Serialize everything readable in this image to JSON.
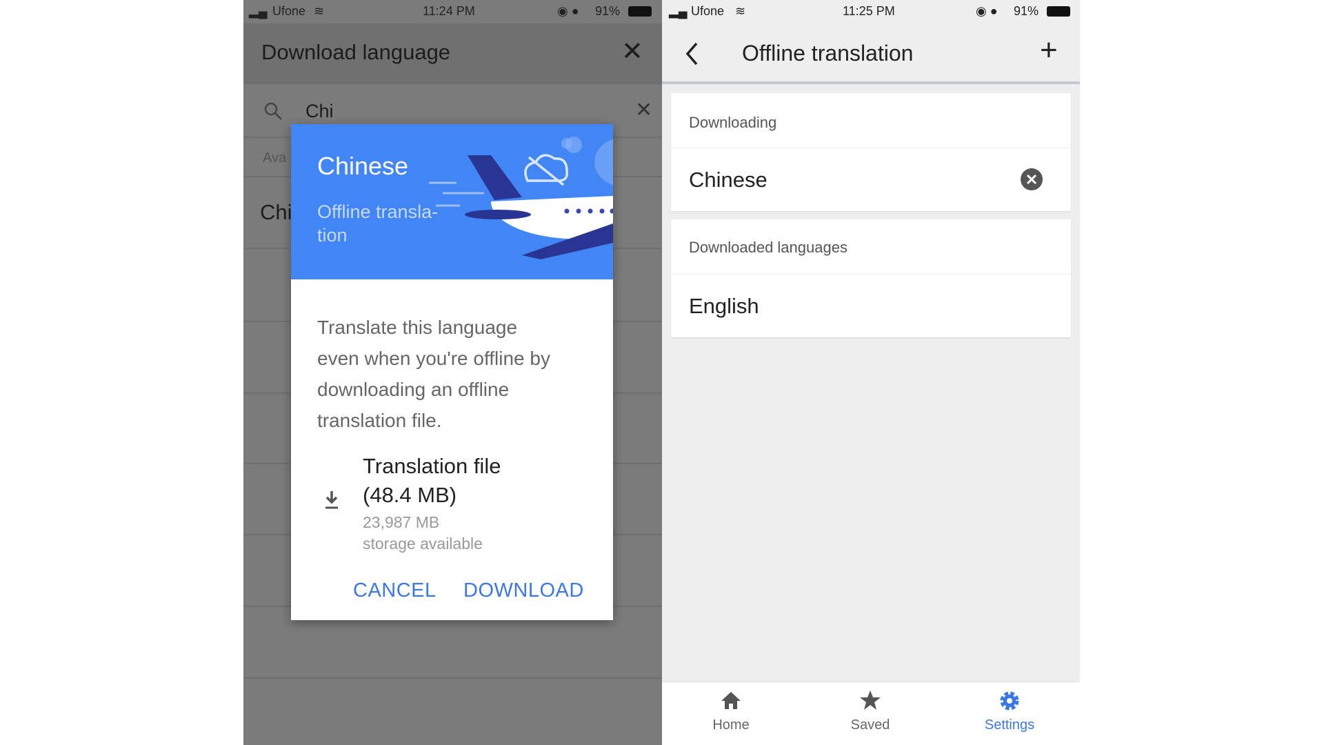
{
  "left_screen": {
    "status": {
      "carrier": "Ufone",
      "time": "11:24 PM",
      "battery": "91%"
    },
    "header": {
      "title": "Download language"
    },
    "search": {
      "value": "Chi"
    },
    "section_header_partial": "Ava",
    "list_item_partial": "Chi",
    "dialog": {
      "title": "Chinese",
      "subtitle_line1": "Offline transla-",
      "subtitle_line2": "tion",
      "body_lines": [
        "Translate this language",
        "even when you're offline by",
        "downloading an offline",
        "translation file."
      ],
      "file_label": "Translation file",
      "file_size": "(48.4 MB)",
      "storage_value": "23,987 MB",
      "storage_label": "storage available",
      "cancel": "CANCEL",
      "download": "DOWNLOAD",
      "accent": "#4285f4"
    }
  },
  "right_screen": {
    "status": {
      "carrier": "Ufone",
      "time": "11:25 PM",
      "battery": "91%"
    },
    "header": {
      "title": "Offline translation"
    },
    "downloading": {
      "header": "Downloading",
      "items": [
        "Chinese"
      ]
    },
    "downloaded": {
      "header": "Downloaded languages",
      "items": [
        "English"
      ]
    },
    "nav": [
      {
        "label": "Home",
        "icon": "home-icon"
      },
      {
        "label": "Saved",
        "icon": "star-icon"
      },
      {
        "label": "Settings",
        "icon": "gear-icon",
        "active": true
      }
    ],
    "active_color": "#3b78e7"
  }
}
